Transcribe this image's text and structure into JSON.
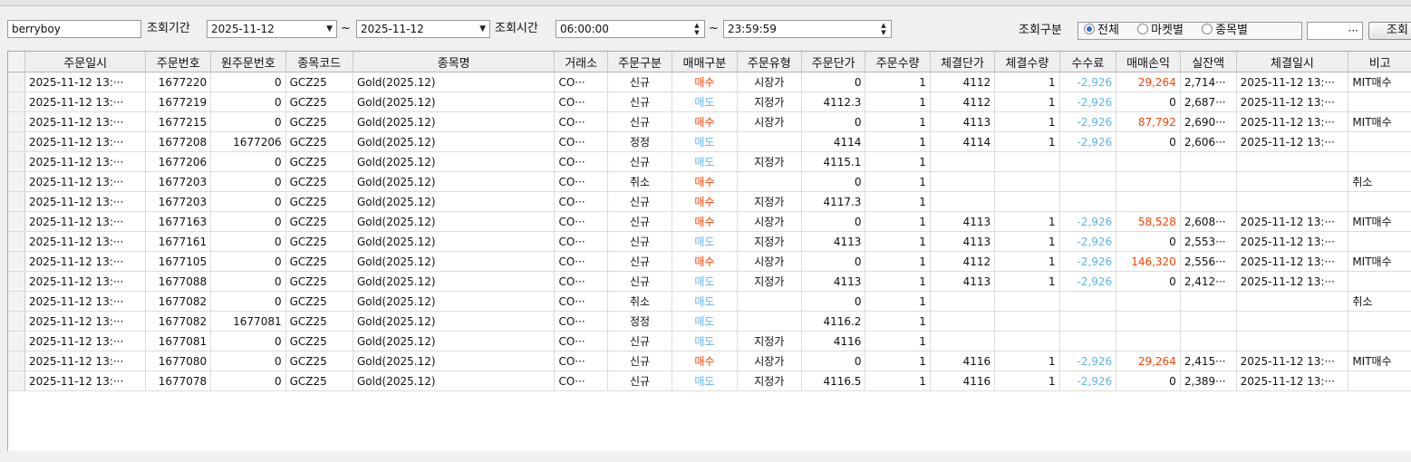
{
  "filters": {
    "account": "berryboy",
    "period_label": "조회기간",
    "date_from": "2025-11-12",
    "tilde": "~",
    "date_to": "2025-11-12",
    "time_label": "조회시간",
    "time_from": "06:00:00",
    "time_to": "23:59:59",
    "type_label": "조회구분",
    "radio_options": [
      {
        "label": "전체",
        "selected": true
      },
      {
        "label": "마켓별",
        "selected": false
      },
      {
        "label": "종목별",
        "selected": false
      }
    ],
    "ellipsis_label": "···",
    "search_label": "조회"
  },
  "grid": {
    "headers": [
      "주문일시",
      "주문번호",
      "원주문번호",
      "종목코드",
      "종목명",
      "거래소",
      "주문구분",
      "매매구분",
      "주문유형",
      "주문단가",
      "주문수량",
      "체결단가",
      "체결수량",
      "수수료",
      "매매손익",
      "실잔액",
      "체결일시",
      "비고"
    ],
    "rows": [
      [
        "2025-11-12 13:···",
        "1677220",
        "0",
        "GCZ25",
        "Gold(2025.12)",
        "CO···",
        "신규",
        "매수",
        "시장가",
        "0",
        "1",
        "4112",
        "1",
        "-2,926",
        "29,264",
        "2,714···",
        "2025-11-12 13:···",
        "MIT매수"
      ],
      [
        "2025-11-12 13:···",
        "1677219",
        "0",
        "GCZ25",
        "Gold(2025.12)",
        "CO···",
        "신규",
        "매도",
        "지정가",
        "4112.3",
        "1",
        "4112",
        "1",
        "-2,926",
        "0",
        "2,687···",
        "2025-11-12 13:···",
        ""
      ],
      [
        "2025-11-12 13:···",
        "1677215",
        "0",
        "GCZ25",
        "Gold(2025.12)",
        "CO···",
        "신규",
        "매수",
        "시장가",
        "0",
        "1",
        "4113",
        "1",
        "-2,926",
        "87,792",
        "2,690···",
        "2025-11-12 13:···",
        "MIT매수"
      ],
      [
        "2025-11-12 13:···",
        "1677208",
        "1677206",
        "GCZ25",
        "Gold(2025.12)",
        "CO···",
        "정정",
        "매도",
        "",
        "4114",
        "1",
        "4114",
        "1",
        "-2,926",
        "0",
        "2,606···",
        "2025-11-12 13:···",
        ""
      ],
      [
        "2025-11-12 13:···",
        "1677206",
        "0",
        "GCZ25",
        "Gold(2025.12)",
        "CO···",
        "신규",
        "매도",
        "지정가",
        "4115.1",
        "1",
        "",
        "",
        "",
        "",
        "",
        "",
        ""
      ],
      [
        "2025-11-12 13:···",
        "1677203",
        "0",
        "GCZ25",
        "Gold(2025.12)",
        "CO···",
        "취소",
        "매수",
        "",
        "0",
        "1",
        "",
        "",
        "",
        "",
        "",
        "",
        "취소"
      ],
      [
        "2025-11-12 13:···",
        "1677203",
        "0",
        "GCZ25",
        "Gold(2025.12)",
        "CO···",
        "신규",
        "매수",
        "지정가",
        "4117.3",
        "1",
        "",
        "",
        "",
        "",
        "",
        "",
        ""
      ],
      [
        "2025-11-12 13:···",
        "1677163",
        "0",
        "GCZ25",
        "Gold(2025.12)",
        "CO···",
        "신규",
        "매수",
        "시장가",
        "0",
        "1",
        "4113",
        "1",
        "-2,926",
        "58,528",
        "2,608···",
        "2025-11-12 13:···",
        "MIT매수"
      ],
      [
        "2025-11-12 13:···",
        "1677161",
        "0",
        "GCZ25",
        "Gold(2025.12)",
        "CO···",
        "신규",
        "매도",
        "지정가",
        "4113",
        "1",
        "4113",
        "1",
        "-2,926",
        "0",
        "2,553···",
        "2025-11-12 13:···",
        ""
      ],
      [
        "2025-11-12 13:···",
        "1677105",
        "0",
        "GCZ25",
        "Gold(2025.12)",
        "CO···",
        "신규",
        "매수",
        "시장가",
        "0",
        "1",
        "4112",
        "1",
        "-2,926",
        "146,320",
        "2,556···",
        "2025-11-12 13:···",
        "MIT매수"
      ],
      [
        "2025-11-12 13:···",
        "1677088",
        "0",
        "GCZ25",
        "Gold(2025.12)",
        "CO···",
        "신규",
        "매도",
        "지정가",
        "4113",
        "1",
        "4113",
        "1",
        "-2,926",
        "0",
        "2,412···",
        "2025-11-12 13:···",
        ""
      ],
      [
        "2025-11-12 13:···",
        "1677082",
        "0",
        "GCZ25",
        "Gold(2025.12)",
        "CO···",
        "취소",
        "매도",
        "",
        "0",
        "1",
        "",
        "",
        "",
        "",
        "",
        "",
        "취소"
      ],
      [
        "2025-11-12 13:···",
        "1677082",
        "1677081",
        "GCZ25",
        "Gold(2025.12)",
        "CO···",
        "정정",
        "매도",
        "",
        "4116.2",
        "1",
        "",
        "",
        "",
        "",
        "",
        "",
        ""
      ],
      [
        "2025-11-12 13:···",
        "1677081",
        "0",
        "GCZ25",
        "Gold(2025.12)",
        "CO···",
        "신규",
        "매도",
        "지정가",
        "4116",
        "1",
        "",
        "",
        "",
        "",
        "",
        "",
        ""
      ],
      [
        "2025-11-12 13:···",
        "1677080",
        "0",
        "GCZ25",
        "Gold(2025.12)",
        "CO···",
        "신규",
        "매수",
        "시장가",
        "0",
        "1",
        "4116",
        "1",
        "-2,926",
        "29,264",
        "2,415···",
        "2025-11-12 13:···",
        "MIT매수"
      ],
      [
        "2025-11-12 13:···",
        "1677078",
        "0",
        "GCZ25",
        "Gold(2025.12)",
        "CO···",
        "신규",
        "매도",
        "지정가",
        "4116.5",
        "1",
        "4116",
        "1",
        "-2,926",
        "0",
        "2,389···",
        "2025-11-12 13:···",
        ""
      ]
    ]
  },
  "colors": {
    "buy": "#ff4000",
    "sell": "#5db6e8"
  }
}
